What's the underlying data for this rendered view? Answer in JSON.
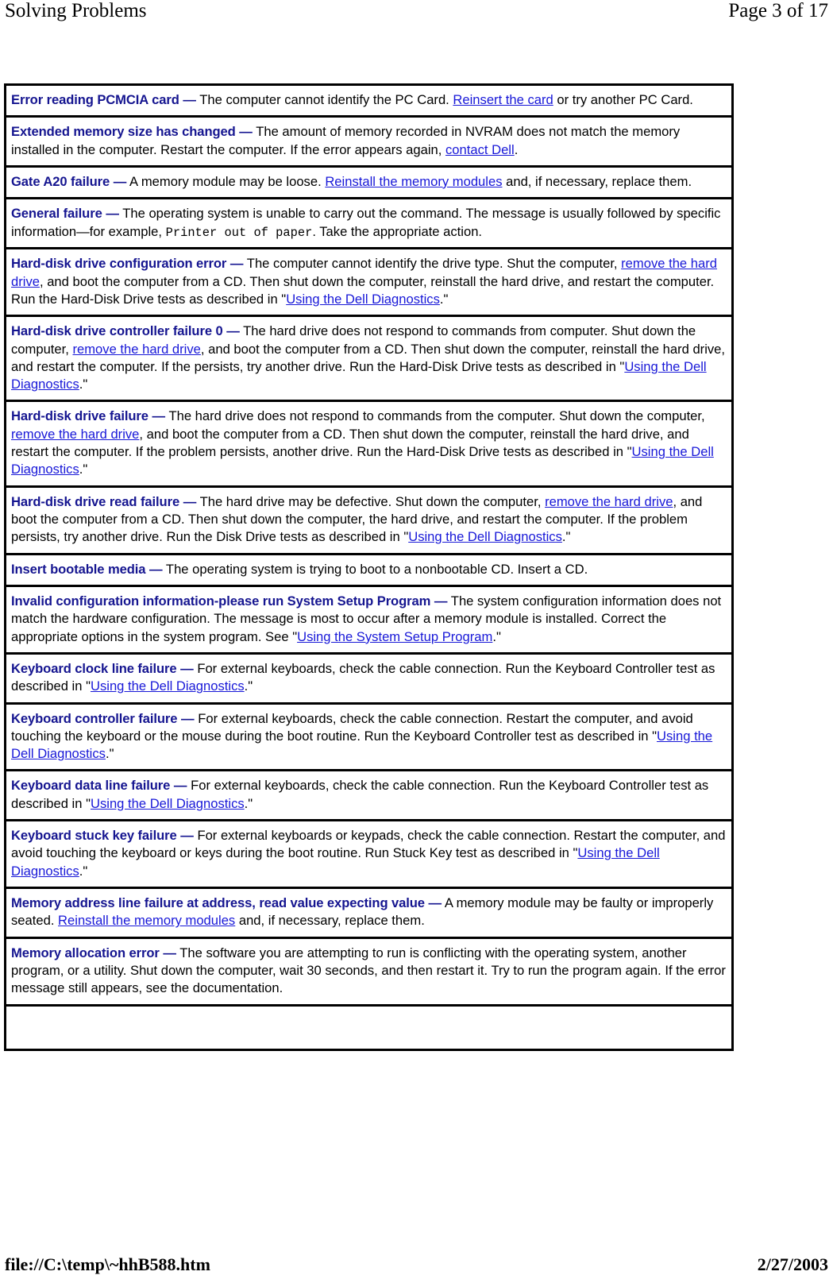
{
  "header": {
    "title": "Solving Problems",
    "page_indicator": "Page 3 of 17"
  },
  "footer": {
    "file_path": "file://C:\\temp\\~hhB588.htm",
    "date": "2/27/2003"
  },
  "colors": {
    "term_navy": "#151590",
    "link_blue": "#1818d8",
    "border_black": "#000000",
    "page_background": "#ffffff"
  },
  "messages": [
    {
      "term": "Error reading PCMCIA card",
      "dash": "—",
      "parts": [
        {
          "type": "text",
          "value": " The computer cannot identify the PC Card. "
        },
        {
          "type": "link",
          "value": "Reinsert the card"
        },
        {
          "type": "text",
          "value": " or try another PC Card."
        }
      ]
    },
    {
      "term": "Extended memory size has changed",
      "dash": "—",
      "parts": [
        {
          "type": "text",
          "value": " The amount of memory recorded in NVRAM does not match the memory installed in the computer. Restart the computer. If the error appears again, "
        },
        {
          "type": "link",
          "value": "contact Dell"
        },
        {
          "type": "text",
          "value": "."
        }
      ]
    },
    {
      "term": "Gate A20 failure",
      "dash": "—",
      "parts": [
        {
          "type": "text",
          "value": " A memory module may be loose. "
        },
        {
          "type": "link",
          "value": "Reinstall the memory modules"
        },
        {
          "type": "text",
          "value": " and, if necessary, replace them."
        }
      ]
    },
    {
      "term": "General failure",
      "dash": "—",
      "parts": [
        {
          "type": "text",
          "value": " The operating system is unable to carry out the command. The message is usually followed by specific information—for example, "
        },
        {
          "type": "mono",
          "value": "Printer out of paper"
        },
        {
          "type": "text",
          "value": ". Take the appropriate action."
        }
      ]
    },
    {
      "term": "Hard-disk drive configuration error",
      "dash": "—",
      "parts": [
        {
          "type": "text",
          "value": " The computer cannot identify the drive type. Shut the computer, "
        },
        {
          "type": "link",
          "value": "remove the hard drive"
        },
        {
          "type": "text",
          "value": ", and boot the computer from a CD. Then shut down the computer, reinstall the hard drive, and restart the computer. Run the Hard-Disk Drive tests as described in \""
        },
        {
          "type": "link",
          "value": "Using the Dell Diagnostics"
        },
        {
          "type": "text",
          "value": ".\""
        }
      ]
    },
    {
      "term": "Hard-disk drive controller failure 0",
      "dash": "—",
      "parts": [
        {
          "type": "text",
          "value": " The hard drive does not respond to commands from computer. Shut down the computer, "
        },
        {
          "type": "link",
          "value": "remove the hard drive"
        },
        {
          "type": "text",
          "value": ", and boot the computer from a CD. Then shut down the computer, reinstall the hard drive, and restart the computer. If the persists, try another drive. Run the Hard-Disk Drive tests as described in \""
        },
        {
          "type": "link",
          "value": "Using the Dell Diagnostics"
        },
        {
          "type": "text",
          "value": ".\""
        }
      ]
    },
    {
      "term": "Hard-disk drive failure",
      "dash": "—",
      "parts": [
        {
          "type": "text",
          "value": " The hard drive does not respond to commands from the computer. Shut down the computer, "
        },
        {
          "type": "link",
          "value": "remove the hard drive"
        },
        {
          "type": "text",
          "value": ", and boot the computer from a CD. Then shut down the computer, reinstall the hard drive, and restart the computer. If the problem persists, another drive. Run the Hard-Disk Drive tests as described in \""
        },
        {
          "type": "link",
          "value": "Using the Dell Diagnostics"
        },
        {
          "type": "text",
          "value": ".\""
        }
      ]
    },
    {
      "term": "Hard-disk drive read failure",
      "dash": "—",
      "parts": [
        {
          "type": "text",
          "value": " The hard drive may be defective. Shut down the computer, "
        },
        {
          "type": "link",
          "value": "remove the hard drive"
        },
        {
          "type": "text",
          "value": ", and boot the computer from a CD. Then shut down the computer, the hard drive, and restart the computer. If the problem persists, try another drive. Run the Disk Drive tests as described in \""
        },
        {
          "type": "link",
          "value": "Using the Dell Diagnostics"
        },
        {
          "type": "text",
          "value": ".\""
        }
      ]
    },
    {
      "term": "Insert bootable media",
      "dash": "—",
      "parts": [
        {
          "type": "text",
          "value": " The operating system is trying to boot to a nonbootable CD. Insert a CD."
        }
      ]
    },
    {
      "term": "Invalid configuration information-please run System Setup Program",
      "dash": "—",
      "parts": [
        {
          "type": "text",
          "value": " The system configuration information does not match the hardware configuration. The message is most to occur after a memory module is installed. Correct the appropriate options in the system program. See \""
        },
        {
          "type": "link",
          "value": "Using the System Setup Program"
        },
        {
          "type": "text",
          "value": ".\""
        }
      ]
    },
    {
      "term": "Keyboard clock line failure",
      "dash": "—",
      "parts": [
        {
          "type": "text",
          "value": " For external keyboards, check the cable connection. Run the Keyboard Controller test as described in \""
        },
        {
          "type": "link",
          "value": "Using the Dell Diagnostics"
        },
        {
          "type": "text",
          "value": ".\""
        }
      ]
    },
    {
      "term": "Keyboard controller failure",
      "dash": "—",
      "parts": [
        {
          "type": "text",
          "value": " For external keyboards, check the cable connection. Restart the computer, and avoid touching the keyboard or the mouse during the boot routine. Run the Keyboard Controller test as described in \""
        },
        {
          "type": "link",
          "value": "Using the Dell Diagnostics"
        },
        {
          "type": "text",
          "value": ".\""
        }
      ]
    },
    {
      "term": "Keyboard data line failure",
      "dash": "—",
      "parts": [
        {
          "type": "text",
          "value": " For external keyboards, check the cable connection. Run the Keyboard Controller test as described in \""
        },
        {
          "type": "link",
          "value": "Using the Dell Diagnostics"
        },
        {
          "type": "text",
          "value": ".\""
        }
      ]
    },
    {
      "term": "Keyboard stuck key failure",
      "dash": "—",
      "parts": [
        {
          "type": "text",
          "value": " For external keyboards or keypads, check the cable connection. Restart the computer, and avoid touching the keyboard or keys during the boot routine. Run Stuck Key test as described in \""
        },
        {
          "type": "link",
          "value": "Using the Dell Diagnostics"
        },
        {
          "type": "text",
          "value": ".\""
        }
      ]
    },
    {
      "term": "Memory address line failure at address, read value expecting value",
      "dash": "—",
      "parts": [
        {
          "type": "text",
          "value": " A memory module may be faulty or improperly seated. "
        },
        {
          "type": "link",
          "value": "Reinstall the memory modules"
        },
        {
          "type": "text",
          "value": " and, if necessary, replace them."
        }
      ]
    },
    {
      "term": "Memory allocation error",
      "dash": "—",
      "parts": [
        {
          "type": "text",
          "value": " The software you are attempting to run is conflicting with the operating system, another program, or a utility. Shut down the computer, wait 30 seconds, and then restart it. Try to run the program again. If the error message still appears, see the documentation."
        }
      ]
    },
    {
      "term": "",
      "dash": "",
      "parts": []
    }
  ]
}
